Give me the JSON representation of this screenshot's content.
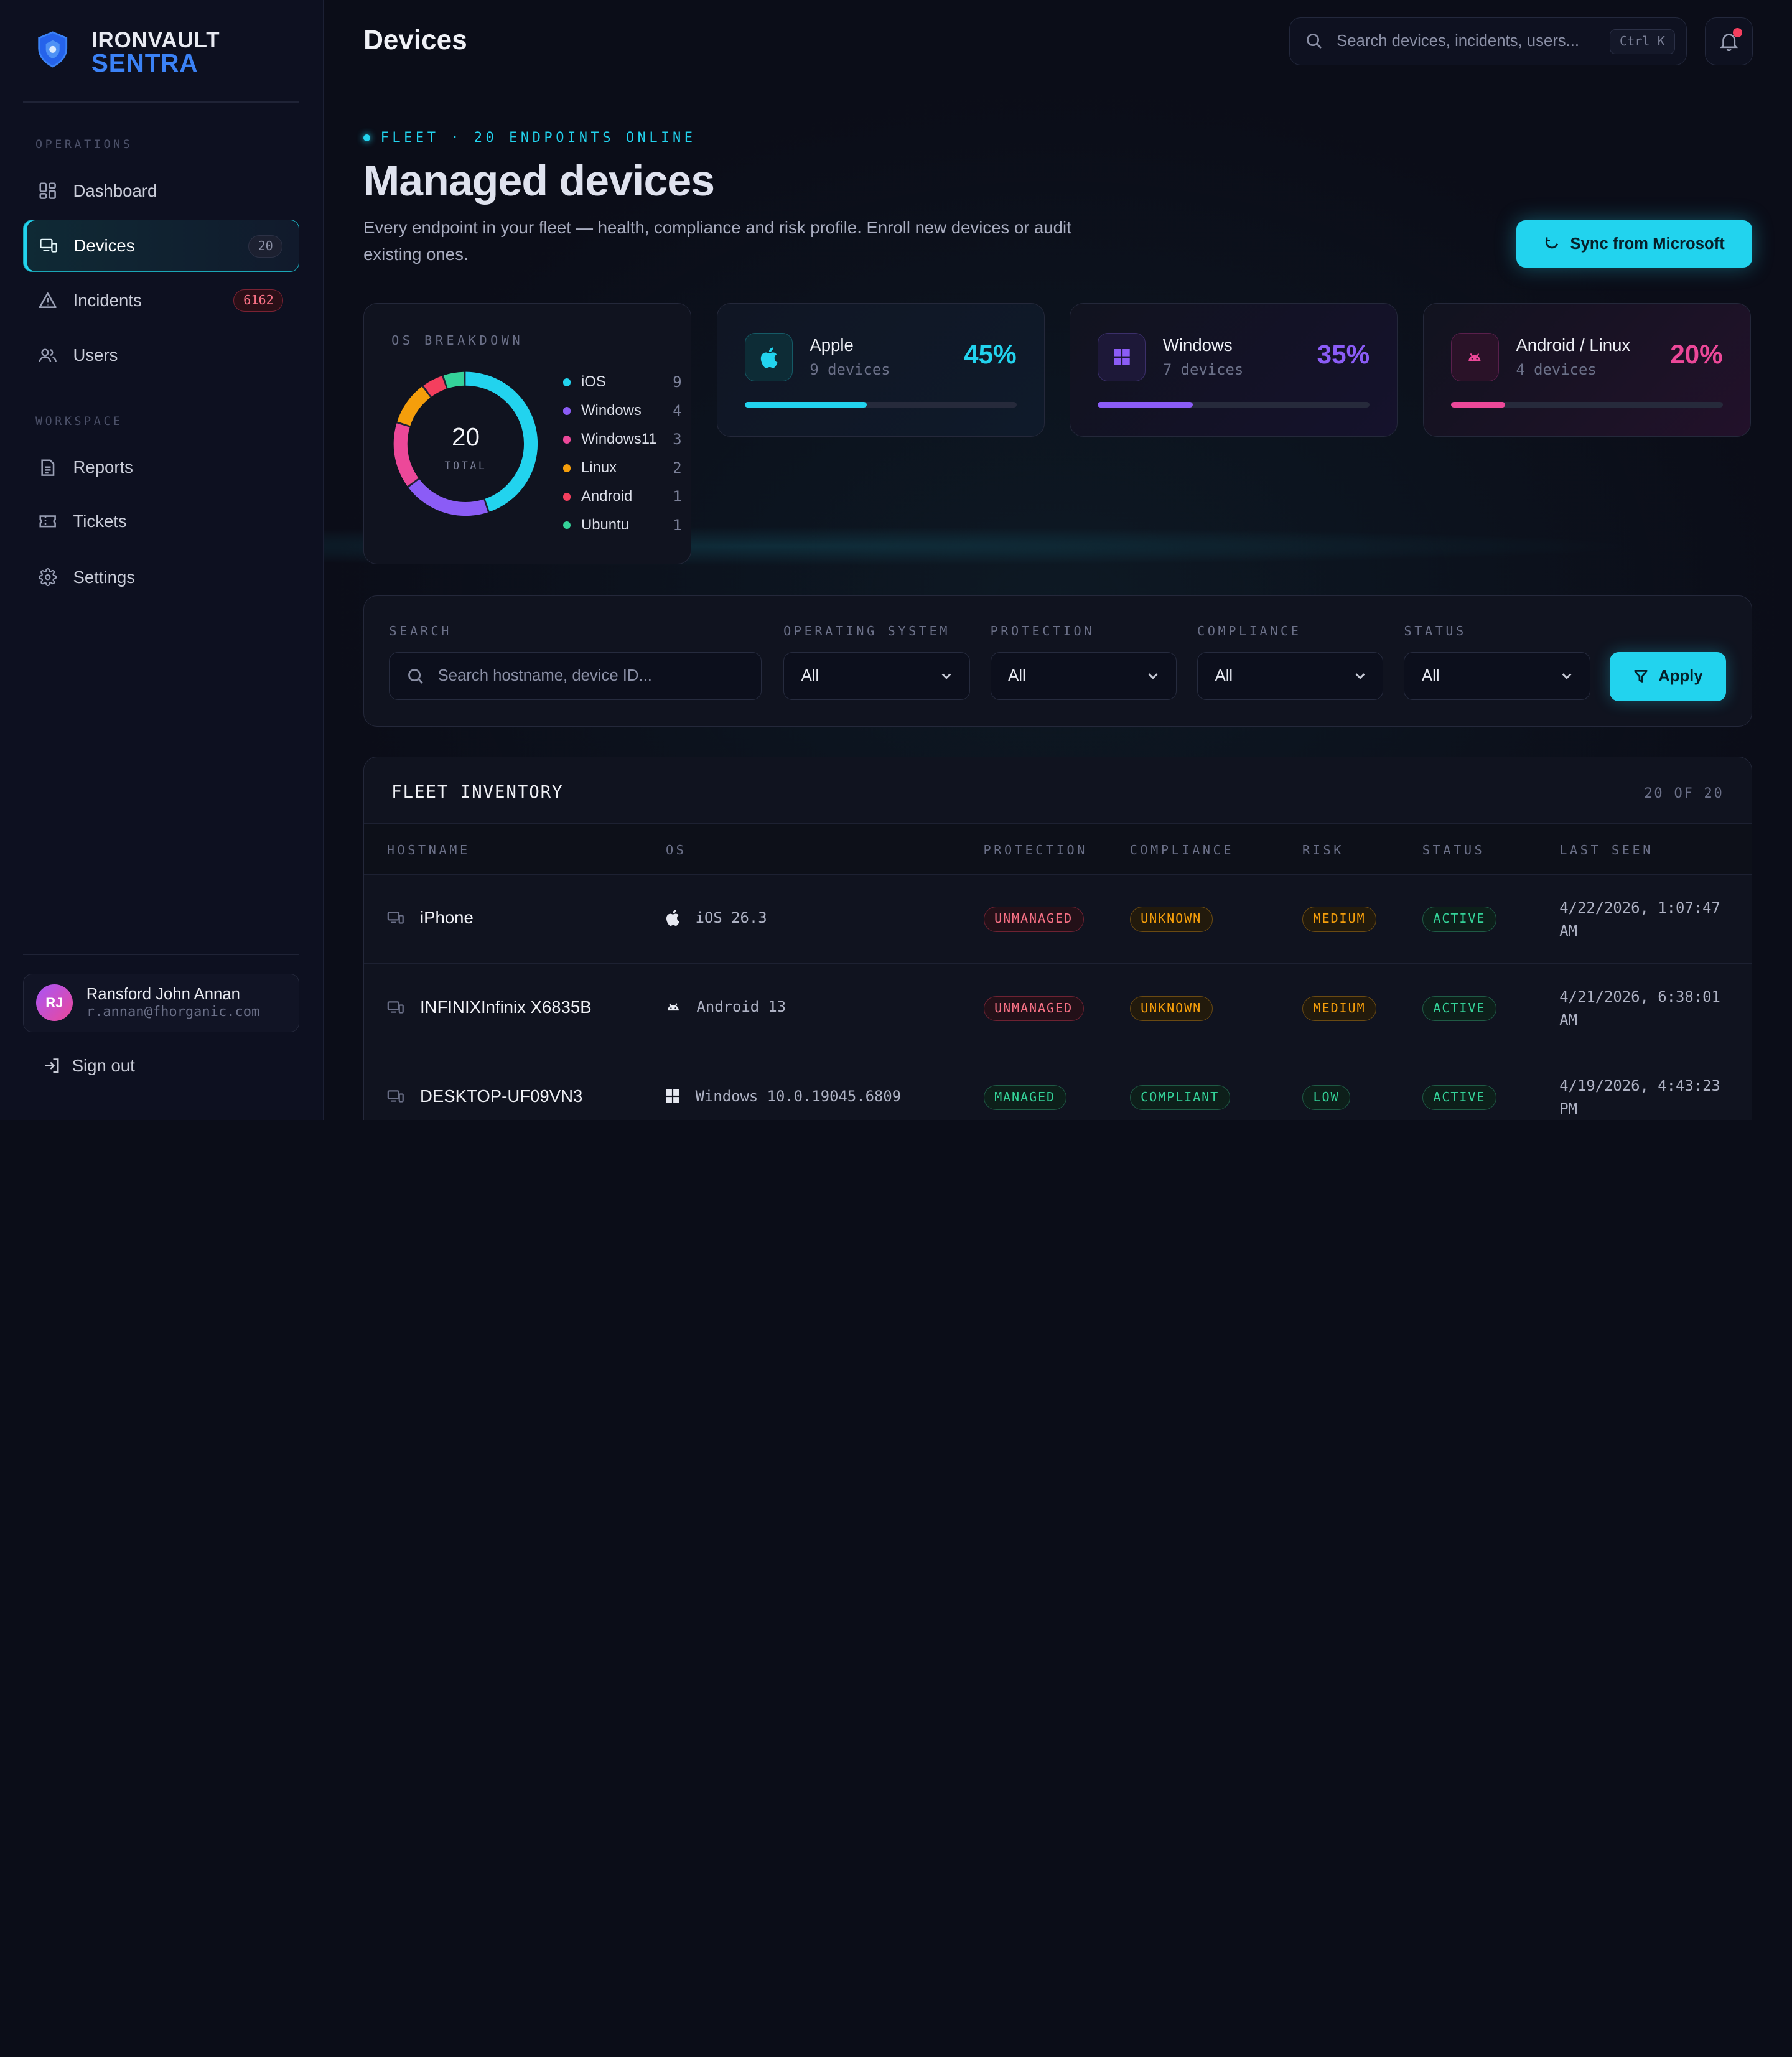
{
  "brand": {
    "line1": "IRONVAULT",
    "line2": "SENTRA"
  },
  "sidebar": {
    "section_ops": "OPERATIONS",
    "section_workspace": "WORKSPACE",
    "items": [
      {
        "label": "Dashboard",
        "icon": "dashboard-icon"
      },
      {
        "label": "Devices",
        "icon": "devices-icon",
        "badge": "20",
        "active": true
      },
      {
        "label": "Incidents",
        "icon": "alert-triangle-icon",
        "badge": "6162"
      },
      {
        "label": "Users",
        "icon": "users-icon"
      },
      {
        "label": "Reports",
        "icon": "document-icon"
      },
      {
        "label": "Tickets",
        "icon": "ticket-icon"
      },
      {
        "label": "Settings",
        "icon": "gear-icon"
      }
    ],
    "user": {
      "initials": "RJ",
      "name": "Ransford John Annan",
      "email": "r.annan@fhorganic.com"
    },
    "signout": "Sign out"
  },
  "header": {
    "title": "Devices",
    "search_placeholder": "Search devices, incidents, users...",
    "shortcut": "Ctrl K"
  },
  "hero": {
    "eyebrow": "FLEET · 20 ENDPOINTS ONLINE",
    "title": "Managed devices",
    "description": "Every endpoint in your fleet — health, compliance and risk profile. Enroll new devices or audit existing ones.",
    "sync_button": "Sync from Microsoft"
  },
  "os_breakdown": {
    "label": "OS BREAKDOWN",
    "total": "20",
    "total_label": "TOTAL",
    "legend": [
      {
        "name": "iOS",
        "count": 9,
        "color": "#22d3ee"
      },
      {
        "name": "Windows",
        "count": 4,
        "color": "#8b5cf6"
      },
      {
        "name": "Windows11",
        "count": 3,
        "color": "#ec4899"
      },
      {
        "name": "Linux",
        "count": 2,
        "color": "#f59e0b"
      },
      {
        "name": "Android",
        "count": 1,
        "color": "#f43f5e"
      },
      {
        "name": "Ubuntu",
        "count": 1,
        "color": "#34d399"
      }
    ]
  },
  "stats": [
    {
      "name": "Apple",
      "sub": "9 devices",
      "pct": "45%",
      "fraction": 0.45,
      "color": "#22d3ee",
      "icon": "apple-icon"
    },
    {
      "name": "Windows",
      "sub": "7 devices",
      "pct": "35%",
      "fraction": 0.35,
      "color": "#8b5cf6",
      "icon": "windows-icon"
    },
    {
      "name": "Android / Linux",
      "sub": "4 devices",
      "pct": "20%",
      "fraction": 0.2,
      "color": "#ec4899",
      "icon": "android-icon"
    }
  ],
  "filters": {
    "search_label": "SEARCH",
    "search_placeholder": "Search hostname, device ID...",
    "os_label": "OPERATING SYSTEM",
    "os_value": "All",
    "protection_label": "PROTECTION",
    "protection_value": "All",
    "compliance_label": "COMPLIANCE",
    "compliance_value": "All",
    "status_label": "STATUS",
    "status_value": "All",
    "apply": "Apply"
  },
  "inventory": {
    "title": "FLEET INVENTORY",
    "count": "20 OF 20",
    "columns": [
      "HOSTNAME",
      "OS",
      "PROTECTION",
      "COMPLIANCE",
      "RISK",
      "STATUS",
      "LAST SEEN"
    ],
    "rows": [
      {
        "hostname": "iPhone",
        "os": "iOS 26.3",
        "os_icon": "apple-icon",
        "protection": "UNMANAGED",
        "compliance": "UNKNOWN",
        "risk": "MEDIUM",
        "status": "ACTIVE",
        "last_seen": "4/22/2026, 1:07:47 AM"
      },
      {
        "hostname": "INFINIXInfinix X6835B",
        "os": "Android 13",
        "os_icon": "android-icon",
        "protection": "UNMANAGED",
        "compliance": "UNKNOWN",
        "risk": "MEDIUM",
        "status": "ACTIVE",
        "last_seen": "4/21/2026, 6:38:01 AM"
      },
      {
        "hostname": "DESKTOP-UF09VN3",
        "os": "Windows 10.0.19045.6809",
        "os_icon": "windows-icon",
        "protection": "MANAGED",
        "compliance": "COMPLIANT",
        "risk": "LOW",
        "status": "ACTIVE",
        "last_seen": "4/19/2026, 4:43:23 PM"
      }
    ]
  }
}
